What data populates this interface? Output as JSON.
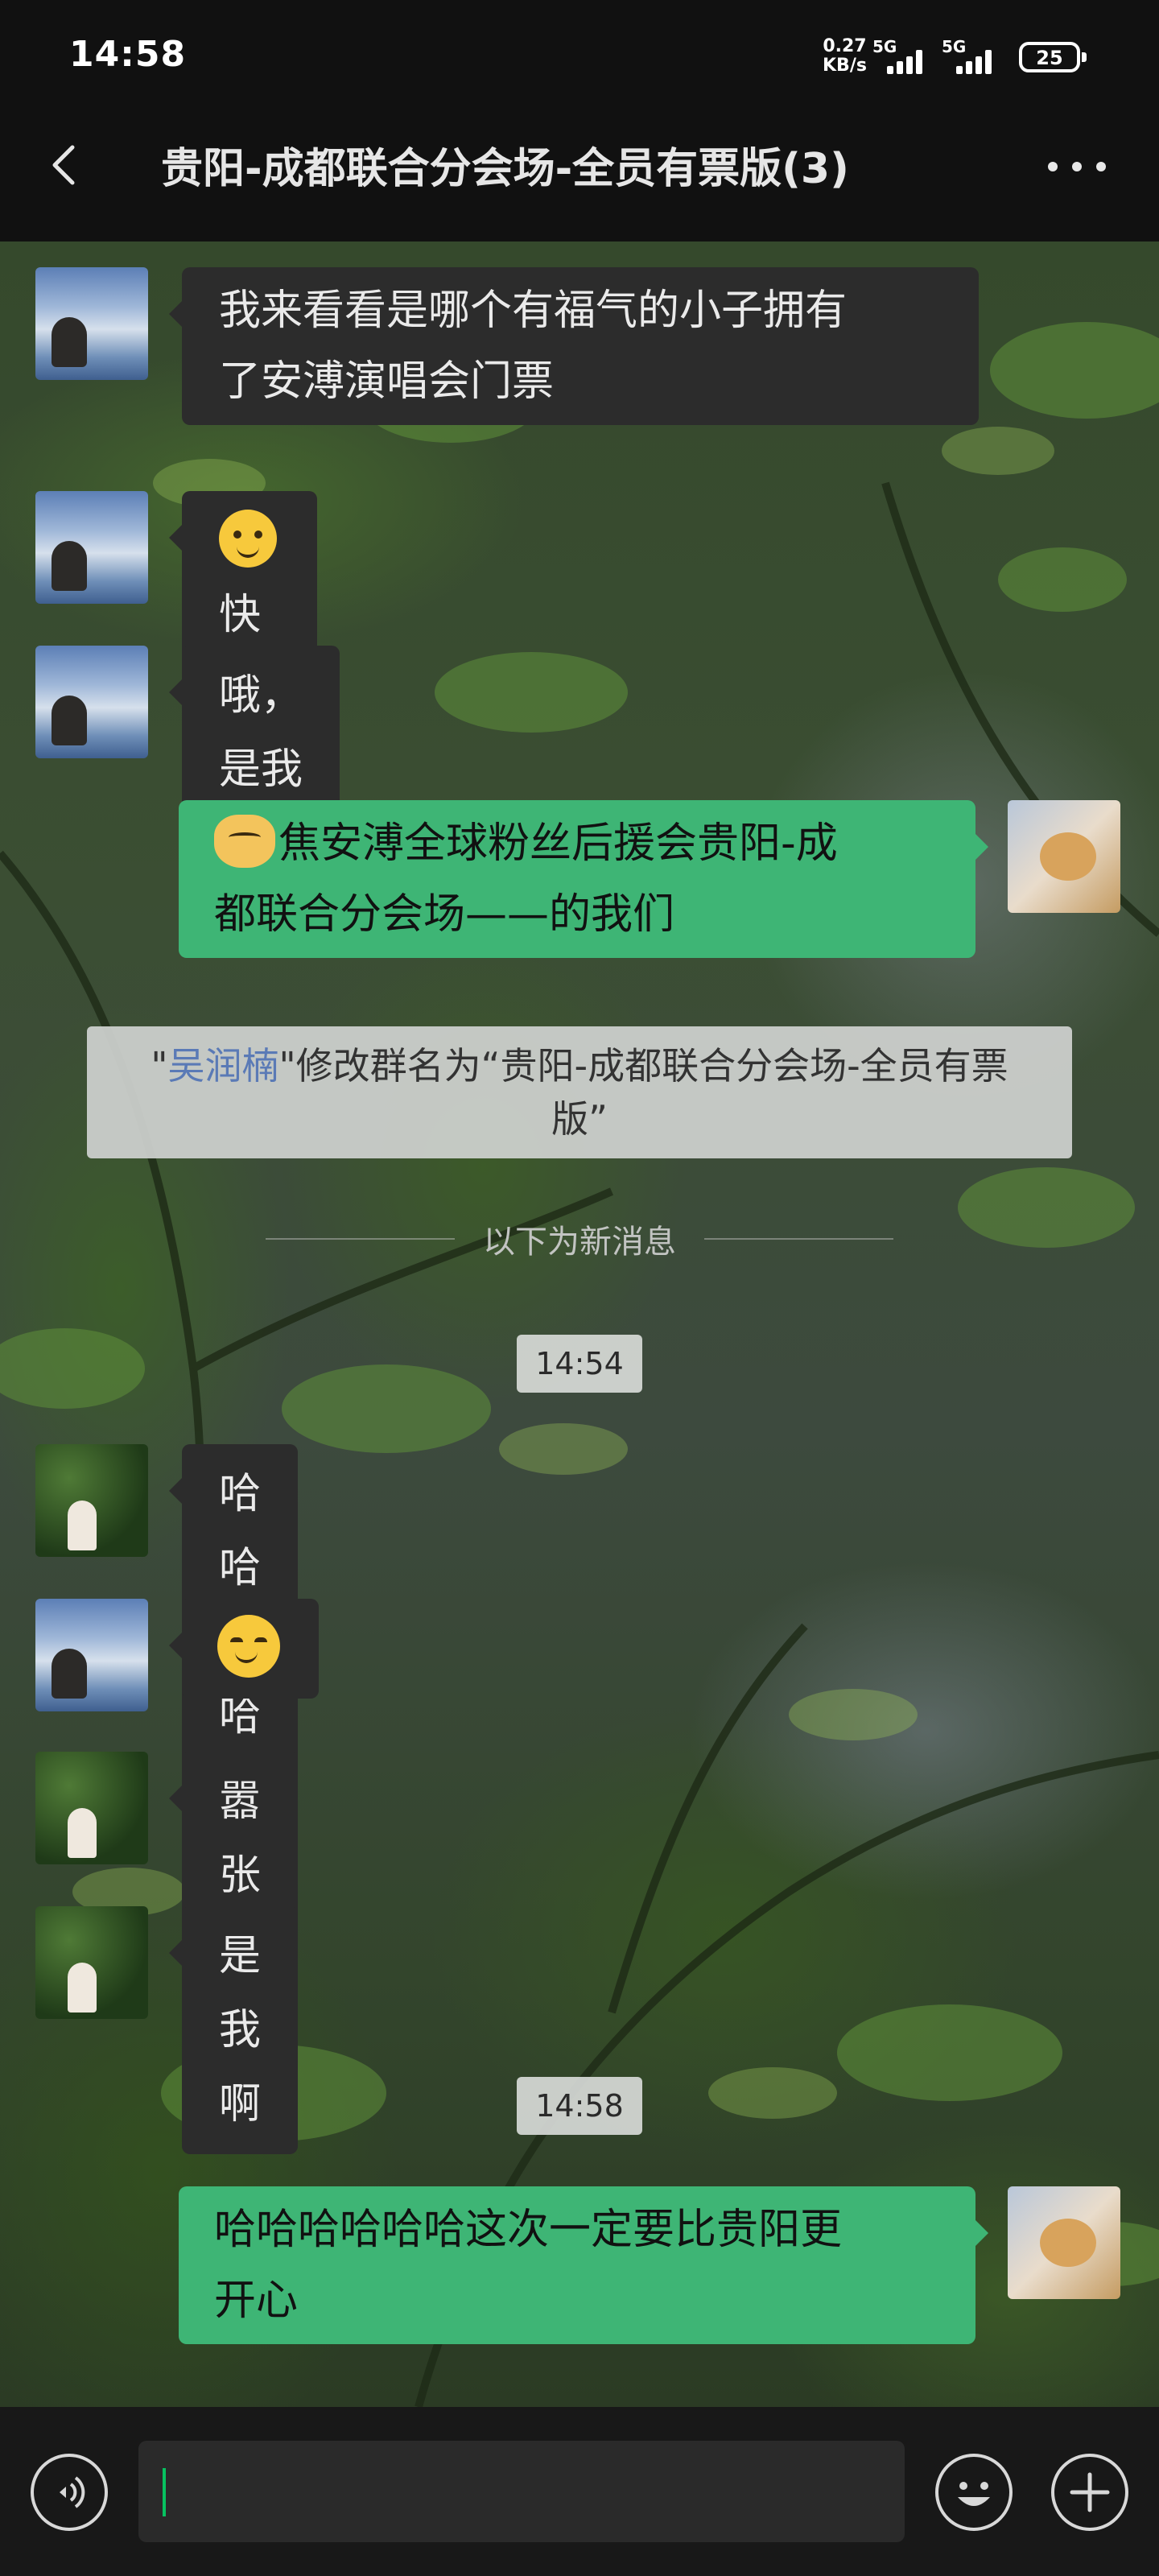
{
  "status_bar": {
    "time": "14:58",
    "net_speed_value": "0.27",
    "net_speed_unit": "KB/s",
    "sim1": "5G",
    "sim2": "5G",
    "battery": "25"
  },
  "header": {
    "title": "贵阳-成都联合分会场-全员有票版(3)",
    "back_icon": "chevron-left-icon",
    "more_icon": "more-dots-icon"
  },
  "messages": [
    {
      "side": "in",
      "avatar": "sky-avatar",
      "lines": [
        "我来看看是哪个有福气的小子拥有",
        "了安溥演唱会门票"
      ]
    },
    {
      "side": "in",
      "avatar": "sky-avatar",
      "emoji": "smile-emoji",
      "text": "快说啊"
    },
    {
      "side": "in",
      "avatar": "sky-avatar",
      "text": "哦，是我"
    },
    {
      "side": "out",
      "avatar": "cat-avatar",
      "emoji": "cat-emoji",
      "lines": [
        "焦安溥全球粉丝后援会贵阳-成",
        "都联合分会场——的我们"
      ]
    }
  ],
  "system_notice": {
    "quote_open": "\"",
    "name": "吴润楠",
    "text_1": "\"修改群名为“贵阳-成都联合分会场-全员有票",
    "text_2": "版”"
  },
  "new_messages_divider": "以下为新消息",
  "time_1": "14:54",
  "messages_2": [
    {
      "side": "in",
      "avatar": "forest-avatar",
      "text": "哈哈哈哈哈"
    },
    {
      "side": "in",
      "avatar": "sky-avatar",
      "emoji": "blush-emoji",
      "text": ""
    },
    {
      "side": "in",
      "avatar": "forest-avatar",
      "text": "嚣张"
    },
    {
      "side": "in",
      "avatar": "forest-avatar",
      "text": "是我啊"
    }
  ],
  "time_2": "14:58",
  "messages_3": [
    {
      "side": "out",
      "avatar": "cat-avatar",
      "lines": [
        "哈哈哈哈哈哈这次一定要比贵阳更",
        "开心"
      ]
    }
  ],
  "input_bar": {
    "voice_icon": "voice-icon",
    "emoji_icon": "emoji-icon",
    "plus_icon": "plus-icon",
    "value": ""
  },
  "colors": {
    "outgoing_bubble": "#3eb575",
    "incoming_bubble": "#2c2c2c",
    "bar_background": "#111111",
    "link_name": "#5a7ab6",
    "cursor": "#07c160"
  }
}
